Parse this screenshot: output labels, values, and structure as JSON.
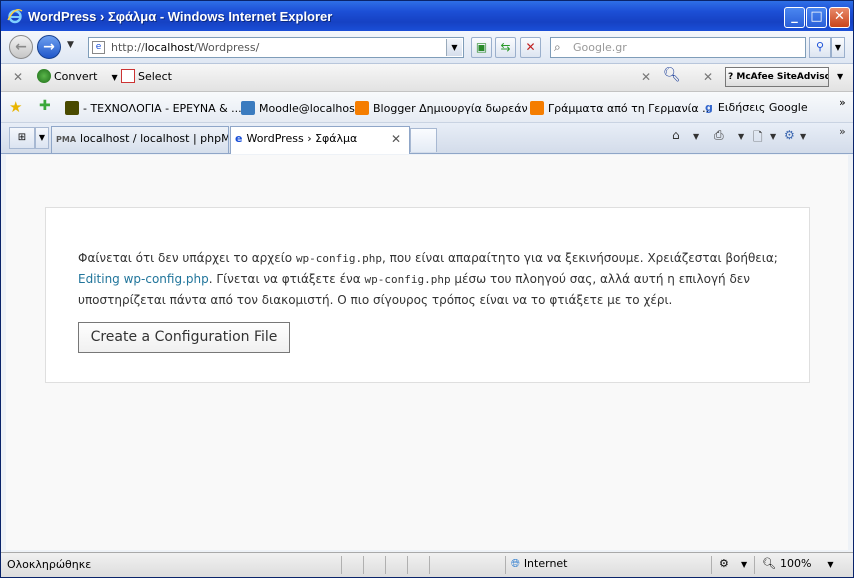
{
  "window": {
    "title": "WordPress › Σφάλμα - Windows Internet Explorer"
  },
  "address": {
    "url_prefix": "http://",
    "url_host": "localhost",
    "url_path": "/Wordpress/"
  },
  "search": {
    "placeholder": "Google.gr"
  },
  "toolbar": {
    "convert_label": "Convert",
    "select_label": "Select",
    "mcafee_label": "McAfee SiteAdvisor"
  },
  "favorites": [
    {
      "label": "- ΤΕΧΝΟΛΟΓΙΑ - ΕΡΕΥΝΑ & ...",
      "color": "#4a4a00"
    },
    {
      "label": "Moodle@localhost",
      "color": "#3a7bbf"
    },
    {
      "label": "Blogger Δημιουργία δωρεάν ...",
      "color": "#f57d00"
    },
    {
      "label": "Γράμματα από τη Γερμανία ...",
      "color": "#f57d00"
    },
    {
      "label": "Ειδήσεις Google",
      "color": "#3366cc"
    }
  ],
  "tabs": [
    {
      "label": "localhost / localhost | phpMy..."
    },
    {
      "label": "WordPress › Σφάλμα"
    }
  ],
  "content": {
    "msg_part1": "Φαίνεται ότι δεν υπάρχει το αρχείο ",
    "msg_code1": "wp-config.php",
    "msg_part2": ", που είναι απαραίτητο για να ξεκινήσουμε. Χρειάζεσται βοήθεια; ",
    "msg_link": "Editing wp-config.php",
    "msg_part3": ". Γίνεται να φτιάξετε ένα ",
    "msg_code2": "wp-config.php",
    "msg_part4": " μέσω του πλοηγού σας, αλλά αυτή η επιλογή δεν υποστηρίζεται πάντα από τον διακομιστή. Ο πιο σίγουρος τρόπος είναι να το φτιάξετε με το χέρι.",
    "button_label": "Create a Configuration File"
  },
  "status": {
    "text": "Ολοκληρώθηκε",
    "zone": "Internet",
    "zoom": "100%"
  }
}
